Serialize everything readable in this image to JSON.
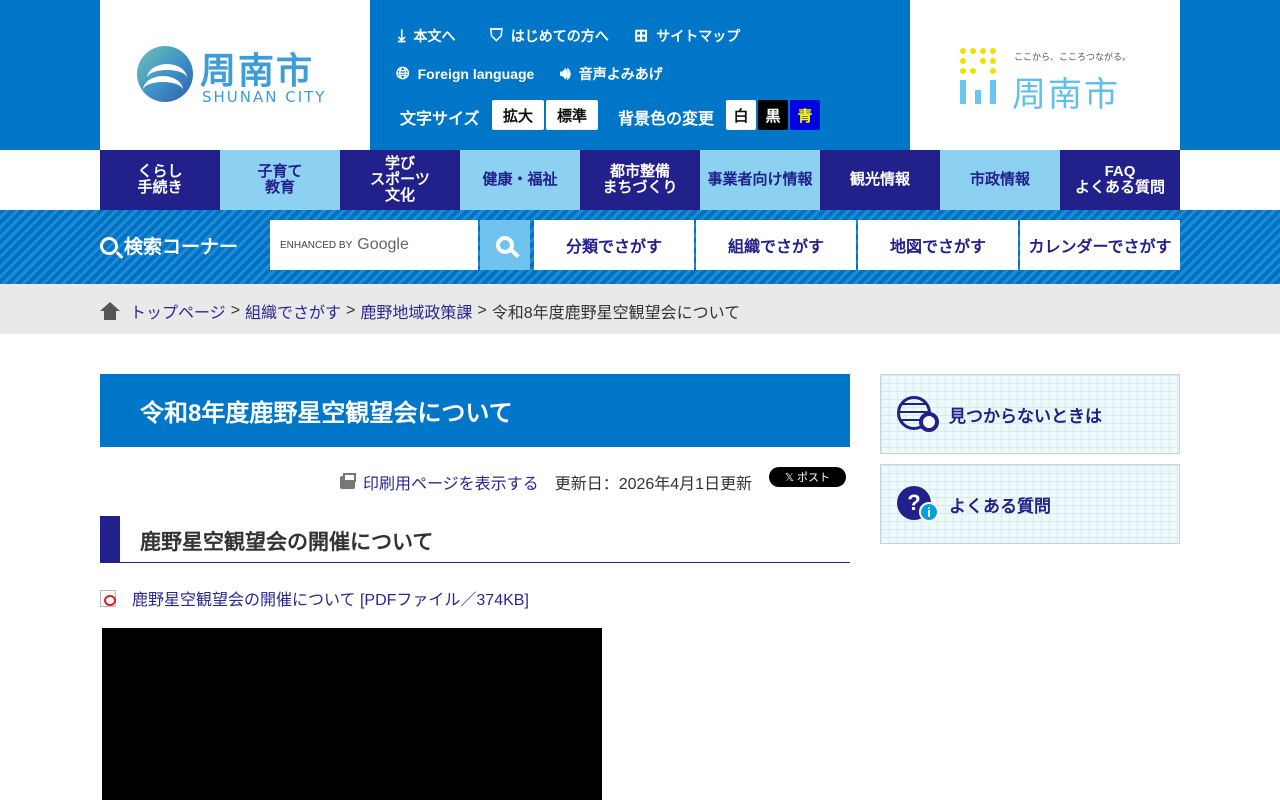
{
  "header": {
    "logo_jp": "周南市",
    "logo_en": "SHUNAN CITY",
    "util_links": [
      {
        "label": "本文へ",
        "icon": "download-icon"
      },
      {
        "label": "はじめての方へ",
        "icon": "shield-icon"
      },
      {
        "label": "サイトマップ",
        "icon": "sitemap-icon"
      },
      {
        "label": "Foreign language",
        "icon": "globe-icon"
      },
      {
        "label": "音声よみあげ",
        "icon": "speaker-icon"
      }
    ],
    "font_size_label": "文字サイズ",
    "font_size_buttons": [
      "拡大",
      "標準"
    ],
    "bg_color_label": "背景色の変更",
    "bg_buttons": [
      "白",
      "黒",
      "青"
    ],
    "brand_tagline": "ここから、こころつながる。",
    "brand_logo": "周南市",
    "accent_color": "#0076c8",
    "nav_dark_color": "#22208a"
  },
  "gnav": [
    {
      "label": "くらし\n手続き"
    },
    {
      "label": "子育て\n教育"
    },
    {
      "label": "学び\nスポーツ\n文化"
    },
    {
      "label": "健康・福祉"
    },
    {
      "label": "都市整備\nまちづくり"
    },
    {
      "label": "事業者向け情報"
    },
    {
      "label": "観光情報"
    },
    {
      "label": "市政情報"
    },
    {
      "label": "FAQ\nよくある質問"
    }
  ],
  "search": {
    "title": "検索コーナー",
    "enhanced": "ENHANCED BY",
    "google": "Google",
    "buttons": [
      "分類でさがす",
      "組織でさがす",
      "地図でさがす",
      "カレンダーでさがす"
    ]
  },
  "breadcrumb": {
    "items": [
      "トップページ",
      "組織でさがす",
      "鹿野地域政策課"
    ],
    "separator": ">",
    "current": "令和8年度鹿野星空観望会について"
  },
  "main": {
    "title": "令和8年度鹿野星空観望会について",
    "print_link": "印刷用ページを表示する",
    "updated": "更新日：2026年4月1日更新",
    "xpost": "𝕏 ポスト",
    "section_heading": "鹿野星空観望会の開催について",
    "pdf_link": "鹿野星空観望会の開催について [PDFファイル／374KB]"
  },
  "sidebar": {
    "items": [
      {
        "label": "見つからないときは",
        "icon": "globe-search-icon"
      },
      {
        "label": "よくある質問",
        "icon": "question-info-icon"
      }
    ]
  }
}
